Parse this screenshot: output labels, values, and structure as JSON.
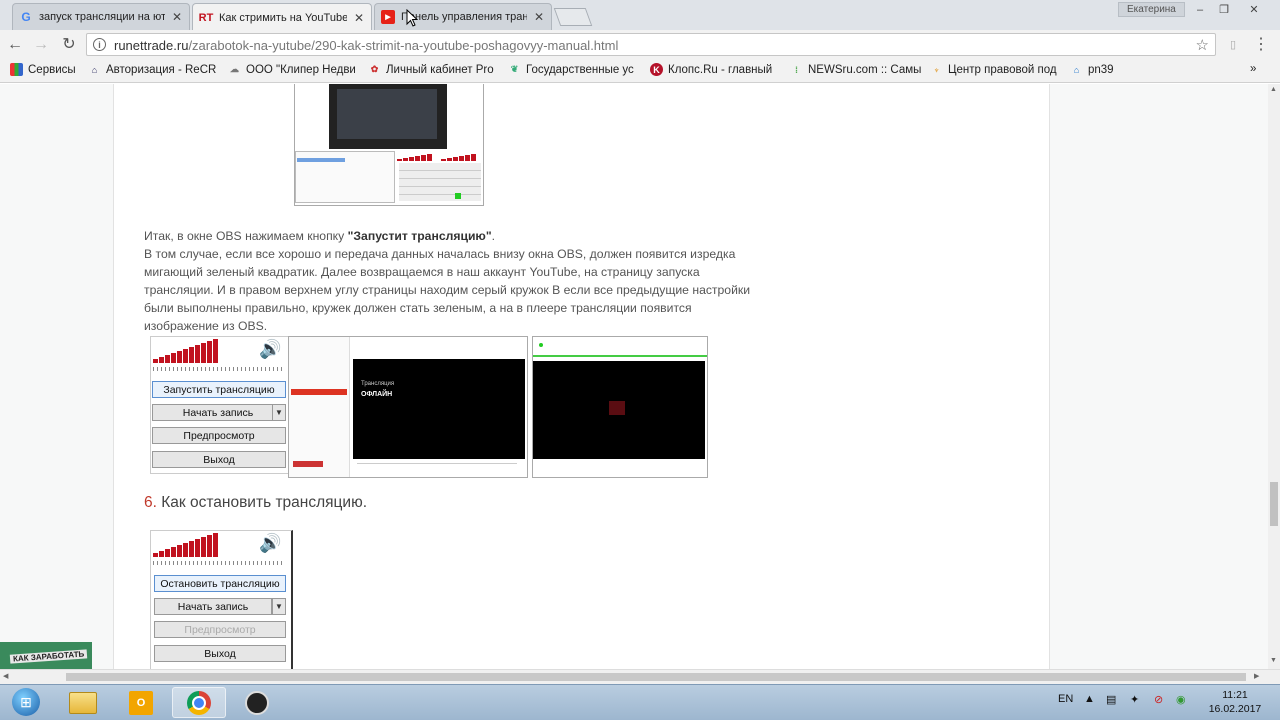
{
  "browser": {
    "tabs": [
      {
        "title": "запуск трансляции на ютуб",
        "favicon": "google-icon",
        "active": false
      },
      {
        "title": "Как стримить на YouTube",
        "favicon": "runettrade-icon",
        "active": true
      },
      {
        "title": "Панель управления трансляцией",
        "favicon": "youtube-icon",
        "active": false
      }
    ],
    "profile_name": "Екатерина",
    "url_host": "runettrade.ru",
    "url_path": "/zarabotok-na-yutube/290-kak-strimit-na-youtube-poshagovyy-manual.html",
    "bookmarks": [
      {
        "label": "Сервисы",
        "icon": "apps-icon"
      },
      {
        "label": "Авторизация - ReCR",
        "icon": "house-icon"
      },
      {
        "label": "ООО \"Клипер Недви",
        "icon": "cloud-icon"
      },
      {
        "label": "Личный кабинет Pro",
        "icon": "puzzle-icon"
      },
      {
        "label": "Государственные ус",
        "icon": "leaf-icon"
      },
      {
        "label": "Клопс.Ru - главный",
        "icon": "klops-icon"
      },
      {
        "label": "NEWSru.com :: Самы",
        "icon": "news-icon"
      },
      {
        "label": "Центр правовой под",
        "icon": "torch-icon"
      },
      {
        "label": "pn39",
        "icon": "school-icon"
      }
    ],
    "bookmarks_more": "»"
  },
  "article": {
    "para_prefix": "Итак, в окне OBS нажимаем кнопку ",
    "para_bold": "\"Запустит трансляцию\"",
    "para_suffix": ".",
    "para_body": "В том случае, если все хорошо и передача данных началась внизу окна OBS, должен появится изредка мигающий зеленый квадратик. Далее возвращаемся в наш аккаунт YouTube, на страницу запуска трансляции. И в правом верхнем углу страницы находим серый кружок В если все предыдущие настройки были выполнены правильно, кружек должен стать зеленым, а на в плеере трансляции появится изображение из OBS.",
    "section_number": "6.",
    "section_title": " Как остановить трансляцию.",
    "obs_start": {
      "start": "Запустить трансляцию",
      "record": "Начать запись",
      "preview": "Предпросмотр",
      "exit": "Выход"
    },
    "obs_stop": {
      "stop": "Остановить трансляцию",
      "record": "Начать запись",
      "preview": "Предпросмотр",
      "exit": "Выход"
    },
    "yt_offline_label": "ОФЛАЙН",
    "yt_player_caption": "Трансляция",
    "banner_text": "КАК ЗАРАБОТАТЬ"
  },
  "taskbar": {
    "language": "EN",
    "time": "11:21",
    "date": "16.02.2017"
  },
  "colors": {
    "accent_red": "#c1121f",
    "link_red": "#c0392b"
  }
}
